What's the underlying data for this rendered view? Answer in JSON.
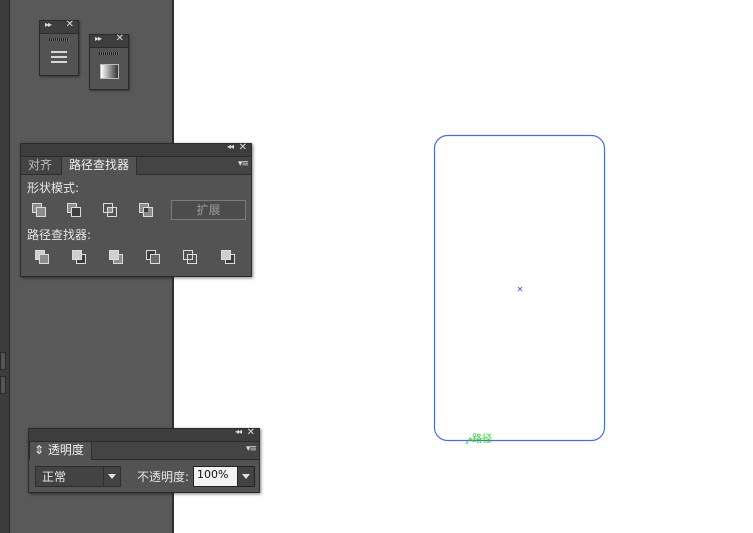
{
  "colors": {
    "dock": "#595959",
    "panel": "#535353",
    "panel_header": "#3d3d3d",
    "canvas": "#ffffff",
    "path_stroke": "#4a6cd4",
    "smart_guide": "#33cc33"
  },
  "mini_panels": [
    {
      "name": "stroke-panel-collapsed",
      "icon": "hamburger-icon"
    },
    {
      "name": "gradient-panel-collapsed",
      "icon": "gradient-icon"
    }
  ],
  "pathfinder": {
    "tabs": [
      {
        "label": "对齐",
        "active": false
      },
      {
        "label": "路径查找器",
        "active": true
      }
    ],
    "shape_modes_label": "形状模式:",
    "shape_modes": [
      "unite-icon",
      "minus-front-icon",
      "intersect-icon",
      "exclude-icon"
    ],
    "expand_label": "扩展",
    "pathfinders_label": "路径查找器:",
    "pathfinders": [
      "divide-icon",
      "trim-icon",
      "merge-icon",
      "crop-icon",
      "outline-icon",
      "minus-back-icon"
    ]
  },
  "transparency": {
    "title": "透明度",
    "blend_mode": "正常",
    "opacity_label": "不透明度:",
    "opacity_value": "100%"
  },
  "canvas": {
    "shape": "rounded-rectangle",
    "hover_label": "路径"
  }
}
